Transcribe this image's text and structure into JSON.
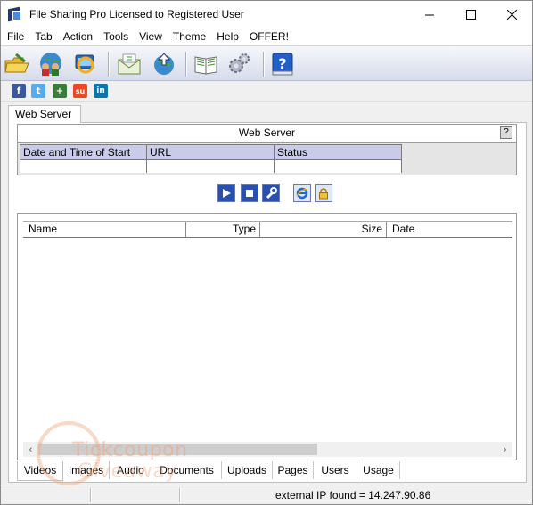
{
  "window": {
    "title": "File Sharing Pro Licensed to Registered User"
  },
  "menu": [
    "File",
    "Tab",
    "Action",
    "Tools",
    "View",
    "Theme",
    "Help",
    "OFFER!"
  ],
  "toolbar_icons": [
    "open-folder-icon",
    "globe-users-icon",
    "users-icon",
    "computer-refresh-icon",
    "mail-icon",
    "upload-globe-icon",
    "book-icon",
    "gears-icon",
    "help-book-icon"
  ],
  "social": [
    {
      "icon": "facebook-icon",
      "glyph": "f",
      "color": "#3b5998"
    },
    {
      "icon": "twitter-icon",
      "glyph": "t",
      "color": "#55acee"
    },
    {
      "icon": "google-plus-icon",
      "glyph": "+",
      "color": "#3a7c3a"
    },
    {
      "icon": "stumbleupon-icon",
      "glyph": "su",
      "color": "#eb4924"
    },
    {
      "icon": "linkedin-icon",
      "glyph": "in",
      "color": "#0e76a8"
    }
  ],
  "top_tab": "Web Server",
  "web_server": {
    "title": "Web Server",
    "help": "?",
    "columns": [
      "Date and Time of Start",
      "URL",
      "Status"
    ]
  },
  "server_controls": [
    "play-icon",
    "stop-icon",
    "settings-wrench-icon",
    "internet-explorer-icon",
    "lock-icon"
  ],
  "files": {
    "columns": [
      "Name",
      "Type",
      "Size",
      "Date"
    ],
    "rows": []
  },
  "bottom_tabs": [
    "Videos",
    "Images",
    "Audio",
    "Documents",
    "Uploads",
    "Pages",
    "Users",
    "Usage"
  ],
  "active_bottom_tab": "Videos",
  "status": {
    "text": "external IP found = 14.247.90.86"
  },
  "watermark": {
    "line1": "Tickcoupon",
    "line2": "Giveaway"
  }
}
